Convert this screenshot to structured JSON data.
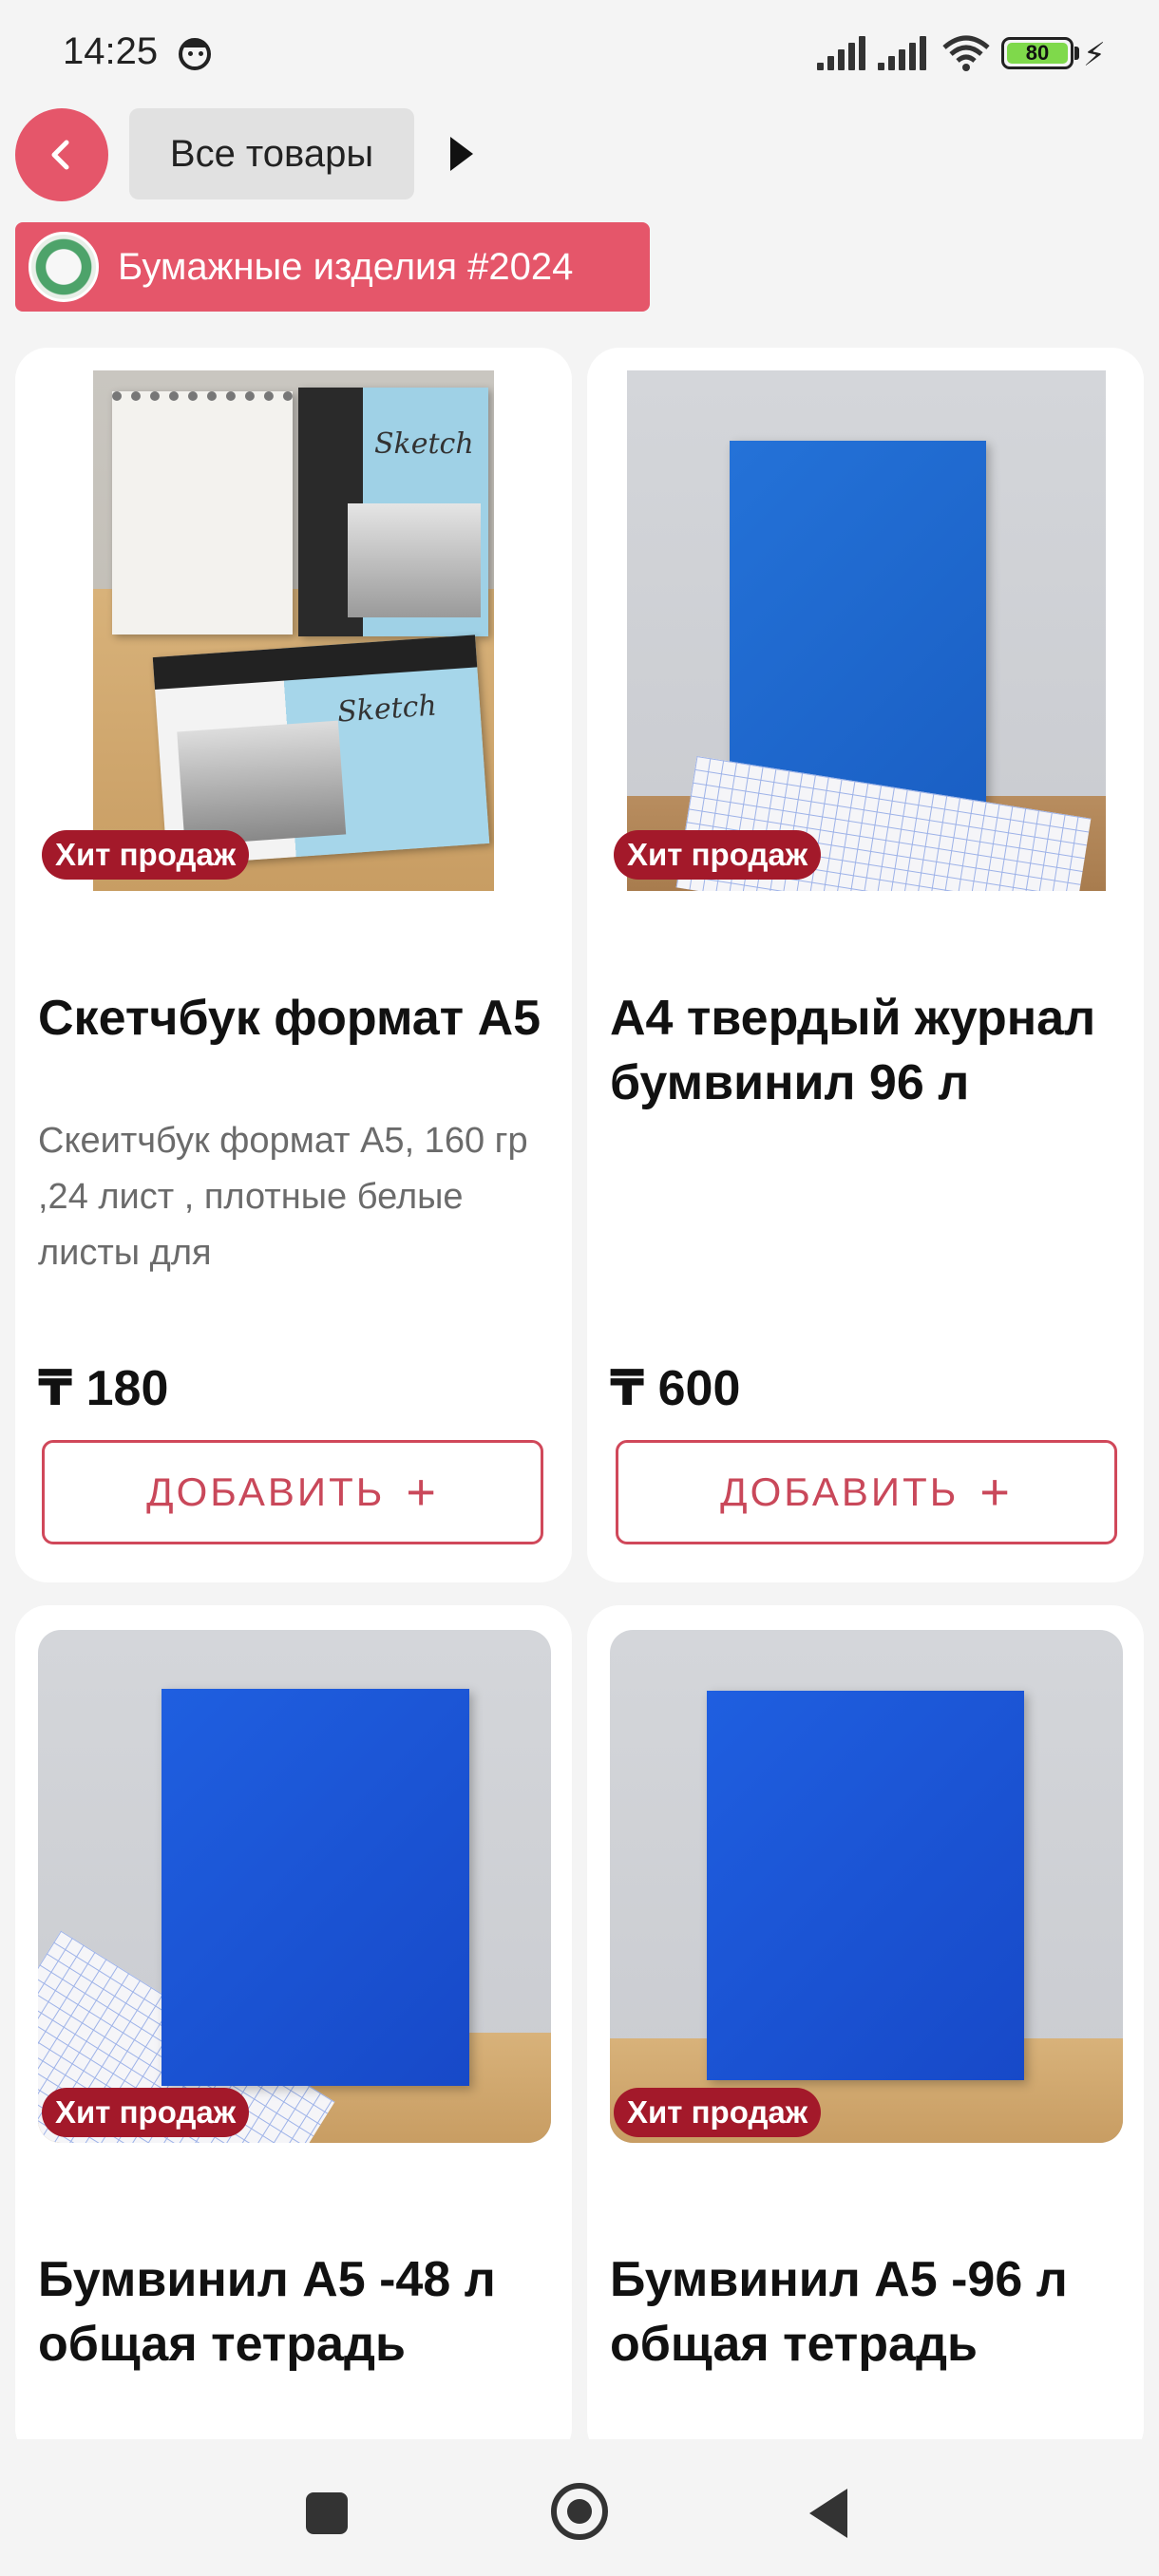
{
  "status_bar": {
    "time": "14:25",
    "battery": "80"
  },
  "header": {
    "back_icon": "chevron-left-icon",
    "all_products_label": "Все товары",
    "more_icon": "play-icon"
  },
  "category": {
    "label": "Бумажные изделия #2024"
  },
  "colors": {
    "accent": "#e5566a",
    "badge": "#a3192a",
    "button_border": "#d0485a"
  },
  "products": [
    {
      "badge": "Хит продаж",
      "title": "Скетчбук формат А5",
      "description": "Скеитчбук формат А5, 160 гр ,24 лист , плотные белые листы для",
      "price": "₸ 180",
      "add_label": "ДОБАВИТЬ",
      "add_icon": "plus-icon"
    },
    {
      "badge": "Хит продаж",
      "title": "А4 твердый журнал бумвинил 96 л",
      "description": "",
      "price": "₸ 600",
      "add_label": "ДОБАВИТЬ",
      "add_icon": "plus-icon"
    },
    {
      "badge": "Хит продаж",
      "title": "Бумвинил А5 -48 л общая тетрадь"
    },
    {
      "badge": "Хит продаж",
      "title": "Бумвинил А5 -96 л общая тетрадь"
    }
  ],
  "nav_bar": {
    "recents_icon": "square-icon",
    "home_icon": "home-circle-icon",
    "back_icon": "triangle-back-icon"
  }
}
